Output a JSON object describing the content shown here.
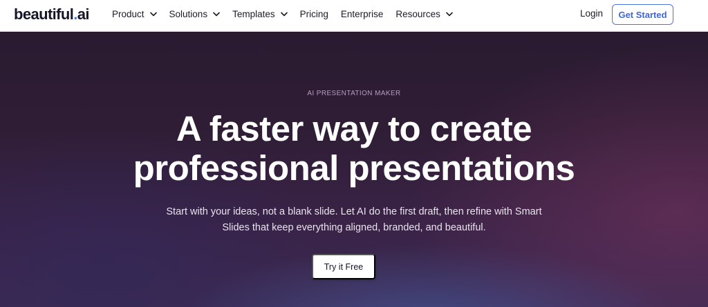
{
  "logo": {
    "text": "beautiful",
    "dot": ".",
    "suffix": "ai"
  },
  "nav": {
    "items": [
      {
        "label": "Product",
        "has_dropdown": true
      },
      {
        "label": "Solutions",
        "has_dropdown": true
      },
      {
        "label": "Templates",
        "has_dropdown": true
      },
      {
        "label": "Pricing",
        "has_dropdown": false
      },
      {
        "label": "Enterprise",
        "has_dropdown": false
      },
      {
        "label": "Resources",
        "has_dropdown": true
      }
    ],
    "login_label": "Login",
    "get_started_label": "Get Started"
  },
  "hero": {
    "eyebrow": "AI PRESENTATION MAKER",
    "title_line1": "A faster way to create",
    "title_line2": "professional presentations",
    "subtitle_line1": "Start with your ideas, not a blank slide. Let AI do the first draft, then refine with Smart",
    "subtitle_line2": "Slides that keep everything aligned, branded, and beautiful.",
    "cta_label": "Try it Free"
  },
  "colors": {
    "brand_blue": "#4c74e6",
    "hero_bg": "#2f1d35",
    "text_dark": "#16162a"
  },
  "icons": {
    "dropdown": "chevron-down-icon"
  }
}
